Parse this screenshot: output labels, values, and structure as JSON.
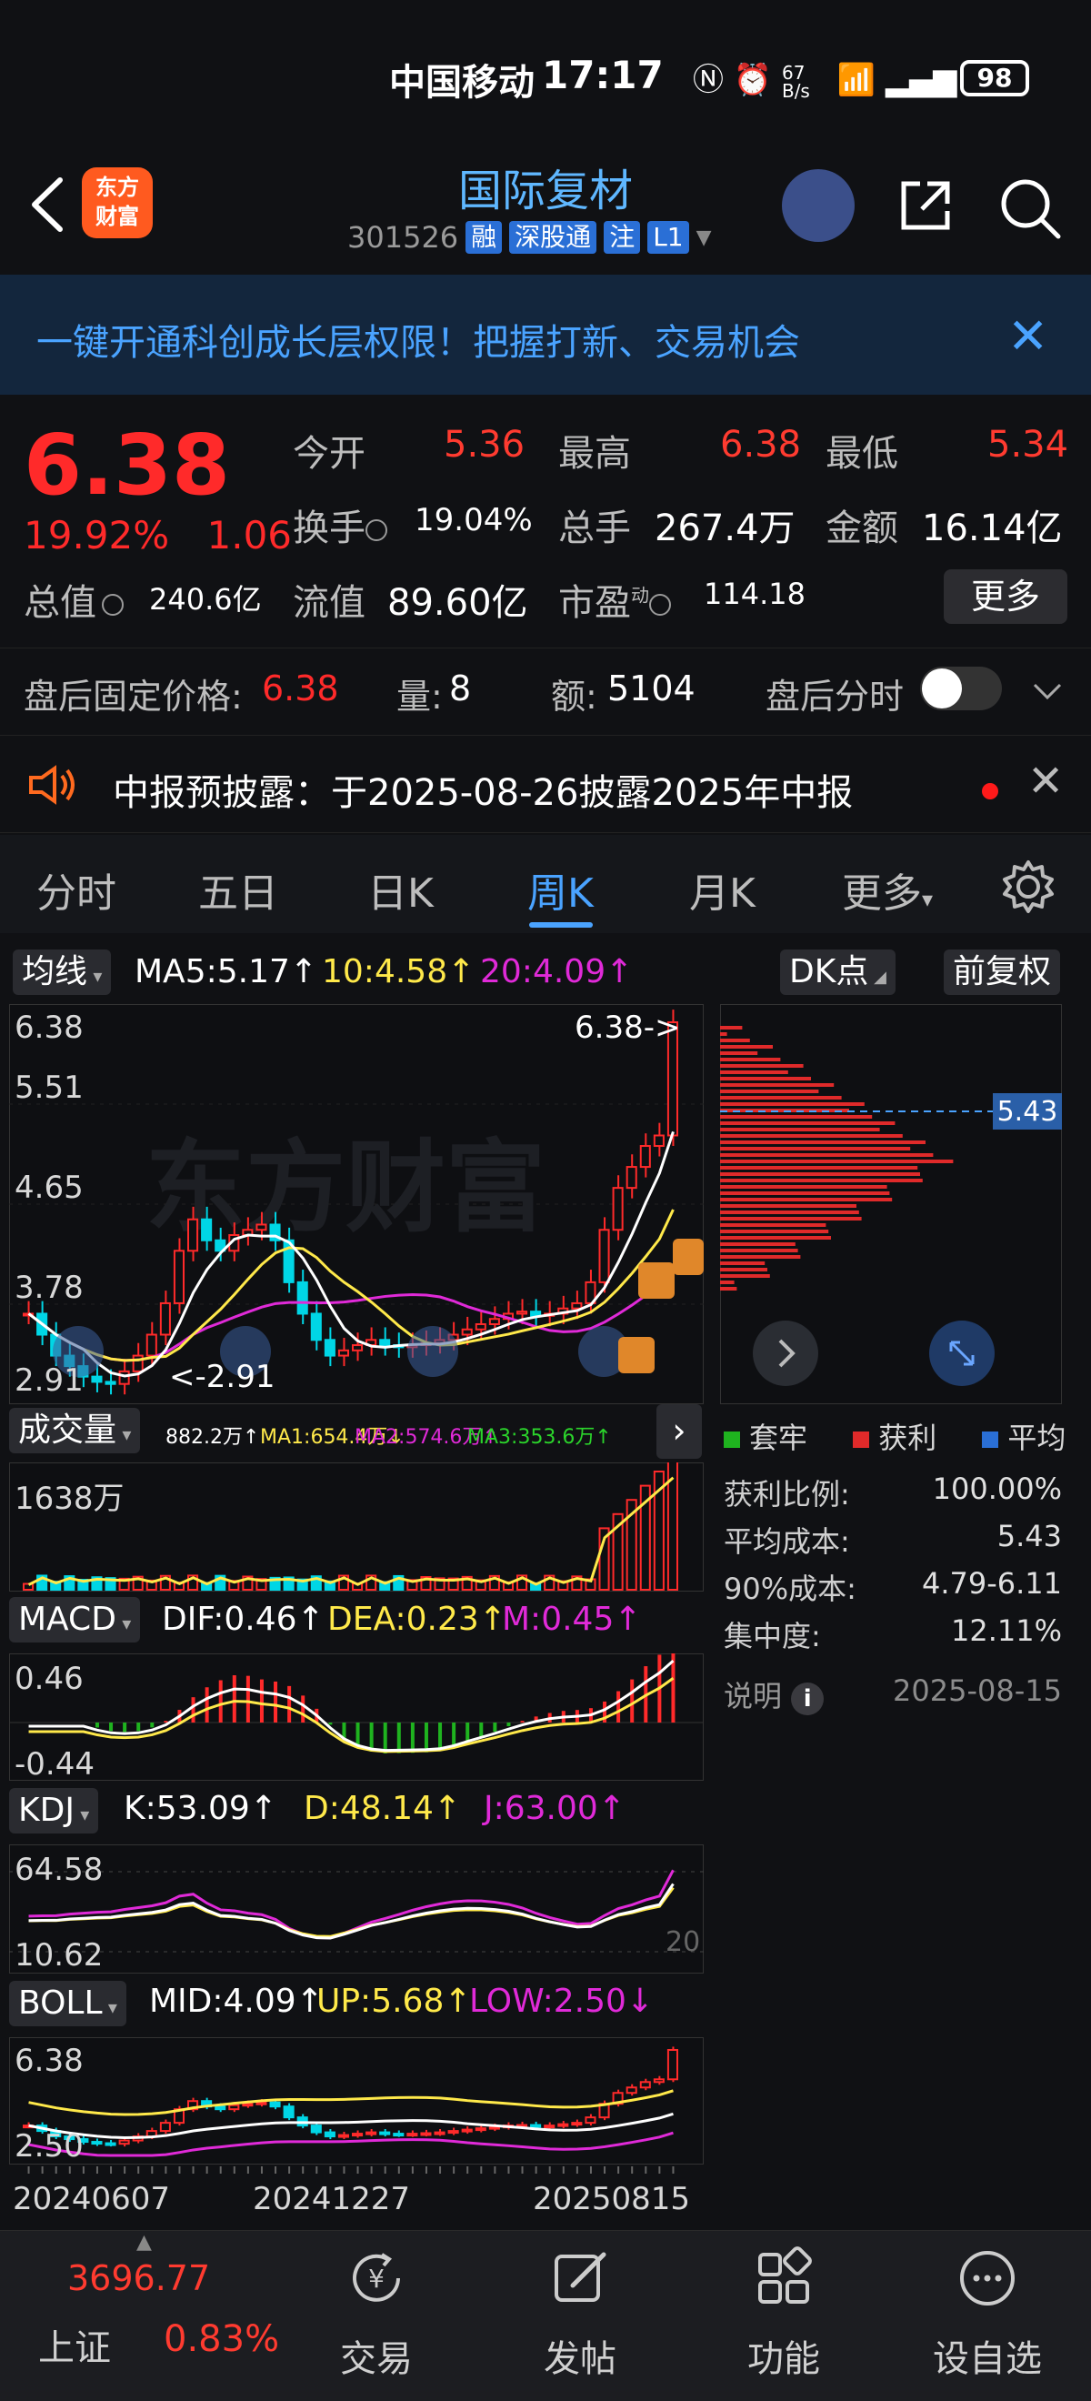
{
  "status_bar": {
    "carrier": "中国移动",
    "time": "17:17",
    "net_speed": "67 B/s",
    "battery": "98"
  },
  "header": {
    "stock_name": "国际复材",
    "stock_code": "301526",
    "tags": [
      "融",
      "深股通",
      "注",
      "L1"
    ],
    "logo_text": "东方财富"
  },
  "banner": {
    "text": "一键开通科创成长层权限！把握打新、交易机会"
  },
  "quote": {
    "price": "6.38",
    "change_pct": "19.92%",
    "change_abs": "1.06",
    "open_label": "今开",
    "open": "5.36",
    "high_label": "最高",
    "high": "6.38",
    "low_label": "最低",
    "low": "5.34",
    "turnover_label": "换手",
    "turnover": "19.04%",
    "volume_label": "总手",
    "volume": "267.4万",
    "amount_label": "金额",
    "amount": "16.14亿",
    "mktcap_label": "总值",
    "mktcap": "240.6亿",
    "float_label": "流值",
    "float": "89.60亿",
    "pe_label": "市盈",
    "pe_sup": "动",
    "pe": "114.18",
    "more": "更多"
  },
  "after_hours": {
    "price_label": "盘后固定价格:",
    "price": "6.38",
    "vol_label": "量:",
    "vol": "8",
    "amt_label": "额:",
    "amt": "5104",
    "timeshare_label": "盘后分时"
  },
  "notice": {
    "text": "中报预披露：于2025-08-26披露2025年中报"
  },
  "tabs": [
    "分时",
    "五日",
    "日K",
    "周K",
    "月K",
    "更多"
  ],
  "chart_header": {
    "ma_label": "均线",
    "ma5": "MA5:5.17↑",
    "ma10": "10:4.58↑",
    "ma20": "20:4.09↑",
    "dk": "DK点",
    "adj": "前复权"
  },
  "price_axis": [
    "6.38",
    "5.51",
    "4.65",
    "3.78",
    "2.91"
  ],
  "price_marks": {
    "high_mark": "6.38->",
    "low_mark": "<-2.91",
    "chip_avg": "5.43"
  },
  "volume_header": {
    "label": "成交量",
    "vol": "882.2万↑",
    "ma1": "MA1:654.4万↓",
    "ma2": "MA2:574.6万↑",
    "ma3": "MA3:353.6万↑",
    "axis_top": "1638万"
  },
  "macd_header": {
    "label": "MACD",
    "dif": "DIF:0.46↑",
    "dea": "DEA:0.23↑",
    "m": "M:0.45↑",
    "axis_top": "0.46",
    "axis_bottom": "-0.44"
  },
  "kdj_header": {
    "label": "KDJ",
    "k": "K:53.09↑",
    "d": "D:48.14↑",
    "j": "J:63.00↑",
    "axis_top": "64.58",
    "axis_bottom": "10.62",
    "axis_right": "20"
  },
  "boll_header": {
    "label": "BOLL",
    "mid": "MID:4.09↑",
    "up": "UP:5.68↑",
    "low": "LOW:2.50↓",
    "axis_top": "6.38",
    "axis_bottom": "2.50"
  },
  "date_axis": [
    "20240607",
    "20241227",
    "20250815"
  ],
  "chip_panel": {
    "legend": [
      "套牢",
      "获利",
      "平均"
    ],
    "rows": [
      {
        "label": "获利比例:",
        "value": "100.00%"
      },
      {
        "label": "平均成本:",
        "value": "5.43"
      },
      {
        "label": "90%成本:",
        "value": "4.79-6.11"
      },
      {
        "label": "集中度:",
        "value": "12.11%"
      }
    ],
    "note_label": "说明",
    "date": "2025-08-15"
  },
  "bottom_nav": {
    "index_value": "3696.77",
    "index_name": "上证",
    "index_change": "0.83%",
    "items": [
      "交易",
      "发帖",
      "功能",
      "设自选"
    ]
  },
  "colors": {
    "up": "#ff2a2a",
    "down": "#00d6e6",
    "accent": "#4aa3ff",
    "ma5": "#ffffff",
    "ma10": "#ffe94a",
    "ma20": "#e02ad8"
  }
}
